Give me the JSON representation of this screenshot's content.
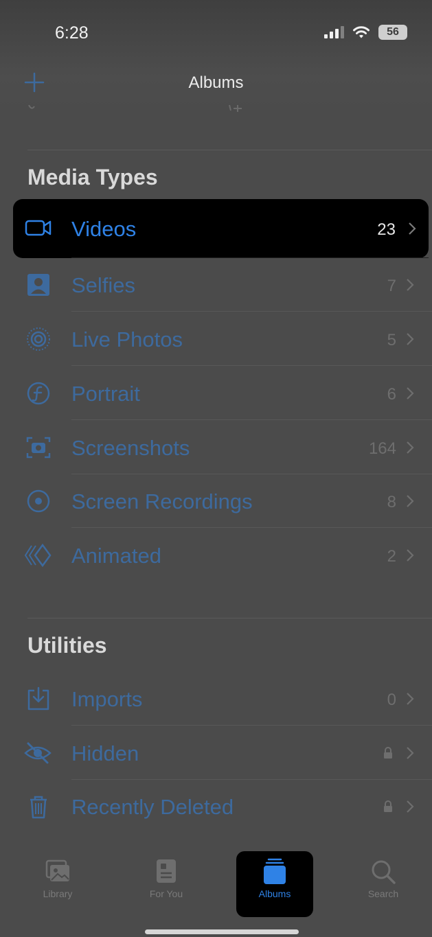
{
  "status_bar": {
    "time": "6:28",
    "battery": "56"
  },
  "nav": {
    "title": "Albums",
    "add_icon": "plus-icon"
  },
  "colors": {
    "accent": "#2f82e6",
    "dim_accent": "#3d6a9e",
    "background": "#4b4b4b"
  },
  "media_types": {
    "title": "Media Types",
    "items": [
      {
        "label": "Videos",
        "count": "23",
        "icon": "video-camera-icon",
        "selected": true
      },
      {
        "label": "Selfies",
        "count": "7",
        "icon": "selfie-portrait-icon"
      },
      {
        "label": "Live Photos",
        "count": "5",
        "icon": "live-photo-icon"
      },
      {
        "label": "Portrait",
        "count": "6",
        "icon": "portrait-aperture-icon"
      },
      {
        "label": "Screenshots",
        "count": "164",
        "icon": "screenshot-icon"
      },
      {
        "label": "Screen Recordings",
        "count": "8",
        "icon": "screen-recording-icon"
      },
      {
        "label": "Animated",
        "count": "2",
        "icon": "animated-layers-icon"
      }
    ]
  },
  "utilities": {
    "title": "Utilities",
    "items": [
      {
        "label": "Imports",
        "count": "0",
        "icon": "import-tray-icon"
      },
      {
        "label": "Hidden",
        "icon": "eye-slash-icon",
        "locked": true
      },
      {
        "label": "Recently Deleted",
        "icon": "trash-icon",
        "locked": true
      }
    ]
  },
  "tab_bar": {
    "tabs": [
      {
        "label": "Library",
        "icon": "photo-library-icon"
      },
      {
        "label": "For You",
        "icon": "for-you-icon"
      },
      {
        "label": "Albums",
        "icon": "albums-stack-icon",
        "active": true
      },
      {
        "label": "Search",
        "icon": "magnifier-icon"
      }
    ]
  }
}
